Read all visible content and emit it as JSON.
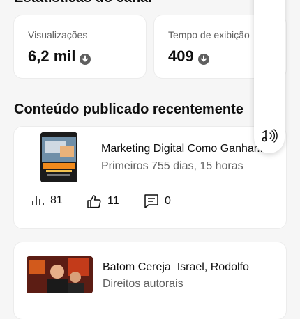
{
  "stats_section": {
    "title": "Estatísticas do canal"
  },
  "stats": [
    {
      "label": "Visualizações",
      "value": "6,2 mil",
      "trend_icon": "arrow-down-circle-icon"
    },
    {
      "label": "Tempo de exibição",
      "value": "409",
      "trend_icon": "arrow-down-circle-icon"
    }
  ],
  "recent_section": {
    "title": "Conteúdo publicado recentemente"
  },
  "videos": [
    {
      "title": "Marketing Digital Como Ganhar...",
      "subtitle": "Primeiros 755 dias, 15 horas",
      "views": "81",
      "likes": "11",
      "comments": "0"
    },
    {
      "title": "Batom Cereja",
      "artists": "Israel, Rodolfo",
      "subtitle": "Direitos autorais"
    }
  ],
  "icons": {
    "views": "bar-chart-icon",
    "likes": "thumb-up-icon",
    "comments": "comment-icon",
    "audio": "audio-note-icon"
  },
  "colors": {
    "text": "#0f0f0f",
    "secondary": "#606060",
    "background": "#f6f6f6"
  }
}
